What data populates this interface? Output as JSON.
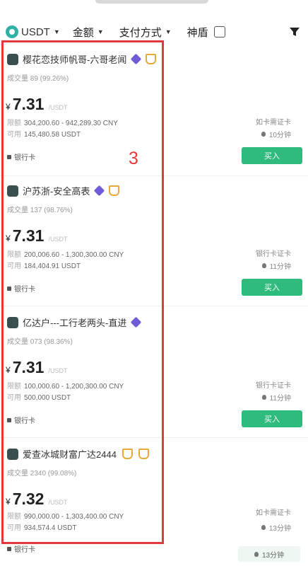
{
  "filter_bar": {
    "coin": "USDT",
    "amount": "金额",
    "payment": "支付方式",
    "fast_label": "神盾"
  },
  "colors": {
    "accent_green": "#2fbb7d",
    "coin_teal": "#2fb1a5",
    "annotation_red": "#e23a3a"
  },
  "annotation": "3",
  "listings": [
    {
      "merchant": "樱花恋技师帆哥-六哥老闻",
      "stats": "成交量 89 (99.26%)",
      "currency_symbol": "¥",
      "price": "7.31",
      "unit": "/USDT",
      "limit_label": "限额",
      "limit": "304,200.60 - 942,289.30 CNY",
      "avail_label": "可用",
      "available": "145,480.58 USDT",
      "payment": "银行卡",
      "right_label": "如卡需证卡",
      "time": "10分钟",
      "buy_label": "买入"
    },
    {
      "merchant": "沪苏浙-安全高表",
      "stats": "成交量 137 (98.76%)",
      "currency_symbol": "¥",
      "price": "7.31",
      "unit": "/USDT",
      "limit_label": "限额",
      "limit": "200,006.60 - 1,300,300.00 CNY",
      "avail_label": "可用",
      "available": "184,404.91 USDT",
      "payment": "银行卡",
      "right_label": "银行卡证卡",
      "time": "11分钟",
      "buy_label": "买入"
    },
    {
      "merchant": "亿达户---工行老两头-直进",
      "stats": "成交量 073 (98.36%)",
      "currency_symbol": "¥",
      "price": "7.31",
      "unit": "/USDT",
      "limit_label": "限额",
      "limit": "100,000.60 - 1,200,300.00 CNY",
      "avail_label": "可用",
      "available": "500,000 USDT",
      "payment": "银行卡",
      "right_label": "银行卡证卡",
      "time": "11分钟",
      "buy_label": "买入"
    },
    {
      "merchant": "爱查冰城财富广达2444",
      "stats": "成交量 2340 (99.08%)",
      "currency_symbol": "¥",
      "price": "7.32",
      "unit": "/USDT",
      "limit_label": "限额",
      "limit": "990,000.00 - 1,303,400.00 CNY",
      "avail_label": "可用",
      "available": "934,574.4 USDT",
      "payment": "银行卡",
      "right_label": "如卡需证卡",
      "time": "13分钟",
      "buy_label": ""
    }
  ],
  "bottom_button": "13分钟"
}
